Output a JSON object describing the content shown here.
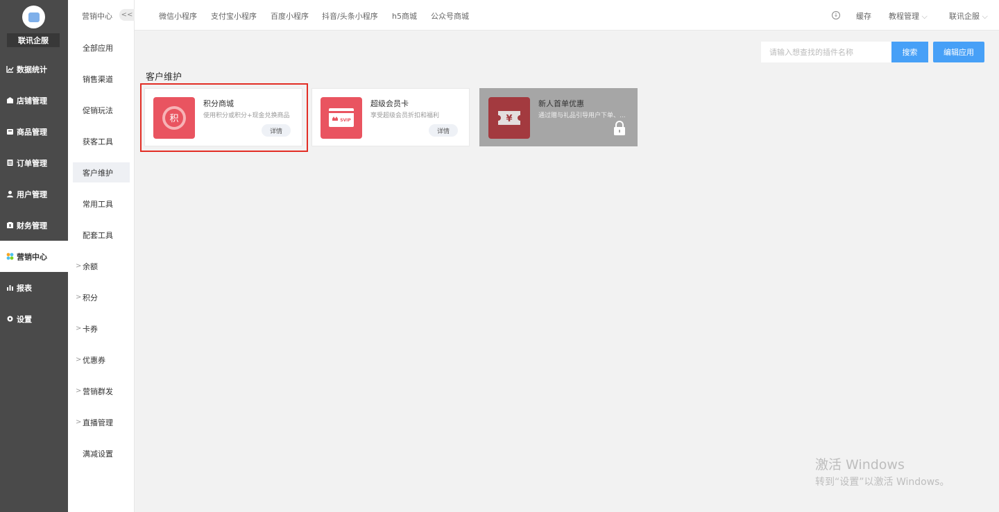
{
  "brand": {
    "name": "联讯企服"
  },
  "nav": [
    {
      "label": "数据统计",
      "icon": "line-chart-icon"
    },
    {
      "label": "店铺管理",
      "icon": "store-icon"
    },
    {
      "label": "商品管理",
      "icon": "goods-icon"
    },
    {
      "label": "订单管理",
      "icon": "order-icon"
    },
    {
      "label": "用户管理",
      "icon": "user-icon"
    },
    {
      "label": "财务管理",
      "icon": "finance-icon"
    },
    {
      "label": "营销中心",
      "icon": "marketing-icon",
      "active": true
    },
    {
      "label": "报表",
      "icon": "report-icon"
    },
    {
      "label": "设置",
      "icon": "gear-icon"
    }
  ],
  "submenu": {
    "title": "营销中心",
    "collapse": "<<",
    "items": [
      {
        "label": "全部应用"
      },
      {
        "label": "销售渠道"
      },
      {
        "label": "促销玩法"
      },
      {
        "label": "获客工具"
      },
      {
        "label": "客户维护",
        "active": true
      },
      {
        "label": "常用工具"
      },
      {
        "label": "配套工具"
      },
      {
        "label": "余额",
        "arrow": ">"
      },
      {
        "label": "积分",
        "arrow": ">"
      },
      {
        "label": "卡券",
        "arrow": ">"
      },
      {
        "label": "优惠券",
        "arrow": ">"
      },
      {
        "label": "营销群发",
        "arrow": ">"
      },
      {
        "label": "直播管理",
        "arrow": ">"
      },
      {
        "label": "满减设置"
      }
    ]
  },
  "topbar": {
    "tabs": [
      "微信小程序",
      "支付宝小程序",
      "百度小程序",
      "抖音/头条小程序",
      "h5商城",
      "公众号商城"
    ],
    "cache": "缓存",
    "tutorial": "教程管理",
    "account": "联讯企服"
  },
  "search": {
    "placeholder": "请输入想查找的插件名称",
    "button": "搜索"
  },
  "edit_button": "编辑应用",
  "section": {
    "title": "客户维护"
  },
  "cards": [
    {
      "name": "积分商城",
      "desc": "使用积分或积分+现金兑换商品",
      "action": "详情",
      "glyph": "积"
    },
    {
      "name": "超级会员卡",
      "desc": "享受超级会员折扣和福利",
      "action": "详情",
      "glyph": "SVIP"
    },
    {
      "name": "新人首单优惠",
      "desc": "通过赠与礼品引导用户下单、...",
      "glyph": "¥",
      "locked": true
    }
  ],
  "watermark": {
    "line1": "激活 Windows",
    "line2": "转到“设置”以激活 Windows。"
  },
  "colors": {
    "accent": "#47a0f7",
    "sidebar": "#4a4a4a",
    "card_icon": "#e95460",
    "highlight": "#e22d24"
  }
}
